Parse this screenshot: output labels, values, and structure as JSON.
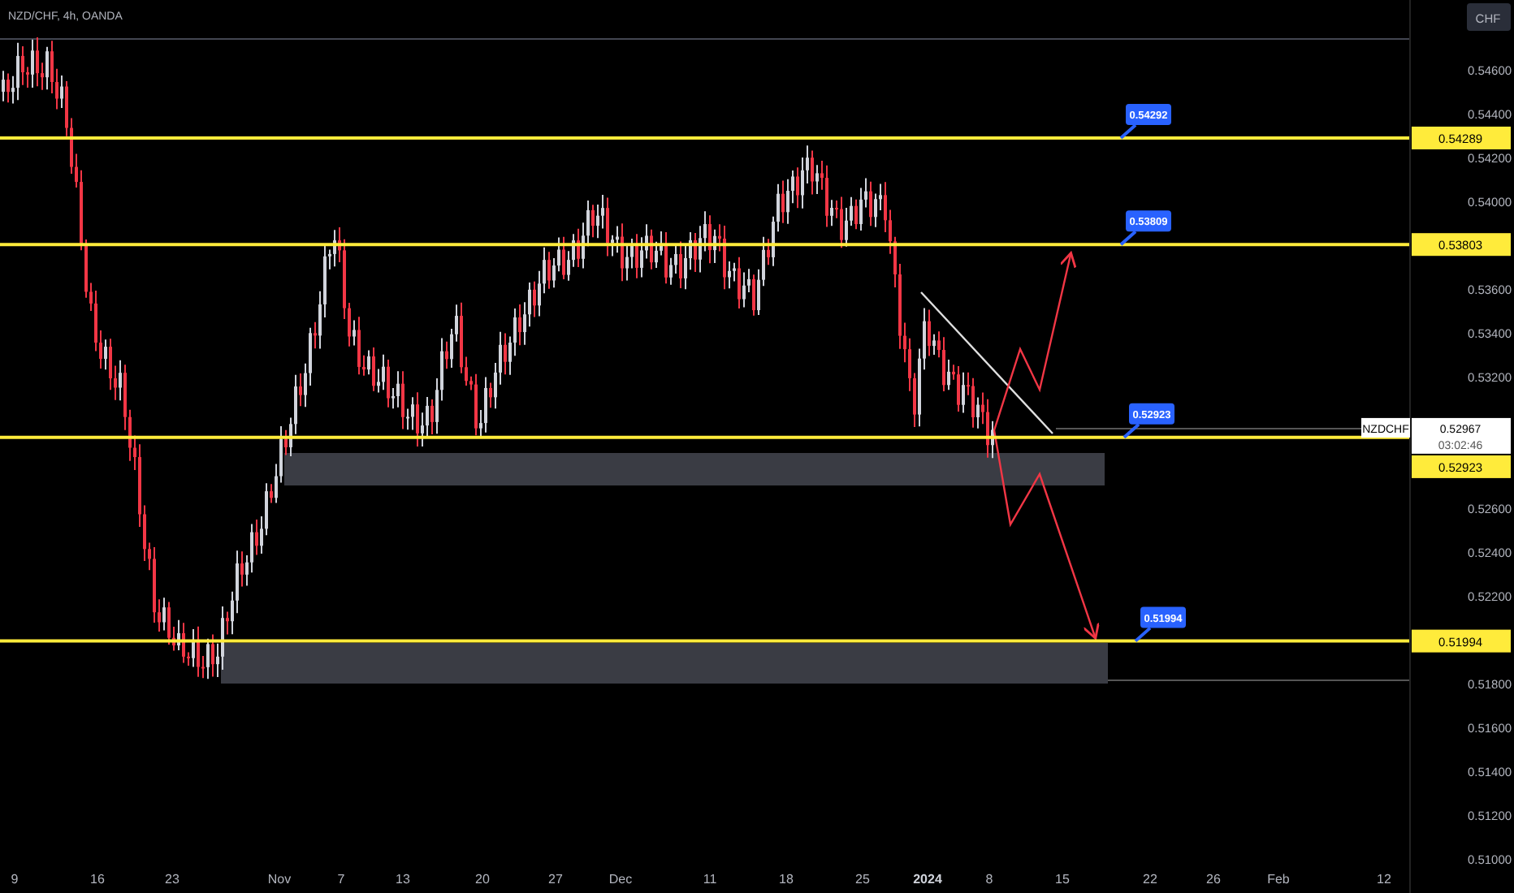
{
  "header": {
    "symbol": "NZD/CHF, 4h, OANDA",
    "currency_button": "CHF"
  },
  "price_axis": {
    "labels": [
      "0.54600",
      "0.54400",
      "0.54200",
      "0.54000",
      "0.53600",
      "0.53400",
      "0.53200",
      "0.52600",
      "0.52400",
      "0.52200",
      "0.51800",
      "0.51600",
      "0.51400",
      "0.51200",
      "0.51000"
    ]
  },
  "levels": [
    {
      "axis_tag": "0.54289",
      "callout": "0.54292"
    },
    {
      "axis_tag": "0.53803",
      "callout": "0.53809"
    },
    {
      "axis_tag": "0.52923",
      "callout": "0.52923"
    },
    {
      "axis_tag": "0.51994",
      "callout": "0.51994"
    }
  ],
  "current_price": {
    "symbol": "NZDCHF",
    "price": "0.52967",
    "countdown": "03:02:46"
  },
  "time_axis": {
    "labels": [
      {
        "text": "9",
        "kind": "day"
      },
      {
        "text": "16",
        "kind": "day"
      },
      {
        "text": "23",
        "kind": "day"
      },
      {
        "text": "Nov",
        "kind": "month"
      },
      {
        "text": "7",
        "kind": "day"
      },
      {
        "text": "13",
        "kind": "day"
      },
      {
        "text": "20",
        "kind": "day"
      },
      {
        "text": "27",
        "kind": "day"
      },
      {
        "text": "Dec",
        "kind": "month"
      },
      {
        "text": "11",
        "kind": "day"
      },
      {
        "text": "18",
        "kind": "day"
      },
      {
        "text": "25",
        "kind": "day"
      },
      {
        "text": "2024",
        "kind": "year"
      },
      {
        "text": "8",
        "kind": "day"
      },
      {
        "text": "15",
        "kind": "day"
      },
      {
        "text": "22",
        "kind": "day"
      },
      {
        "text": "26",
        "kind": "day"
      },
      {
        "text": "Feb",
        "kind": "month"
      },
      {
        "text": "12",
        "kind": "day"
      }
    ]
  }
}
